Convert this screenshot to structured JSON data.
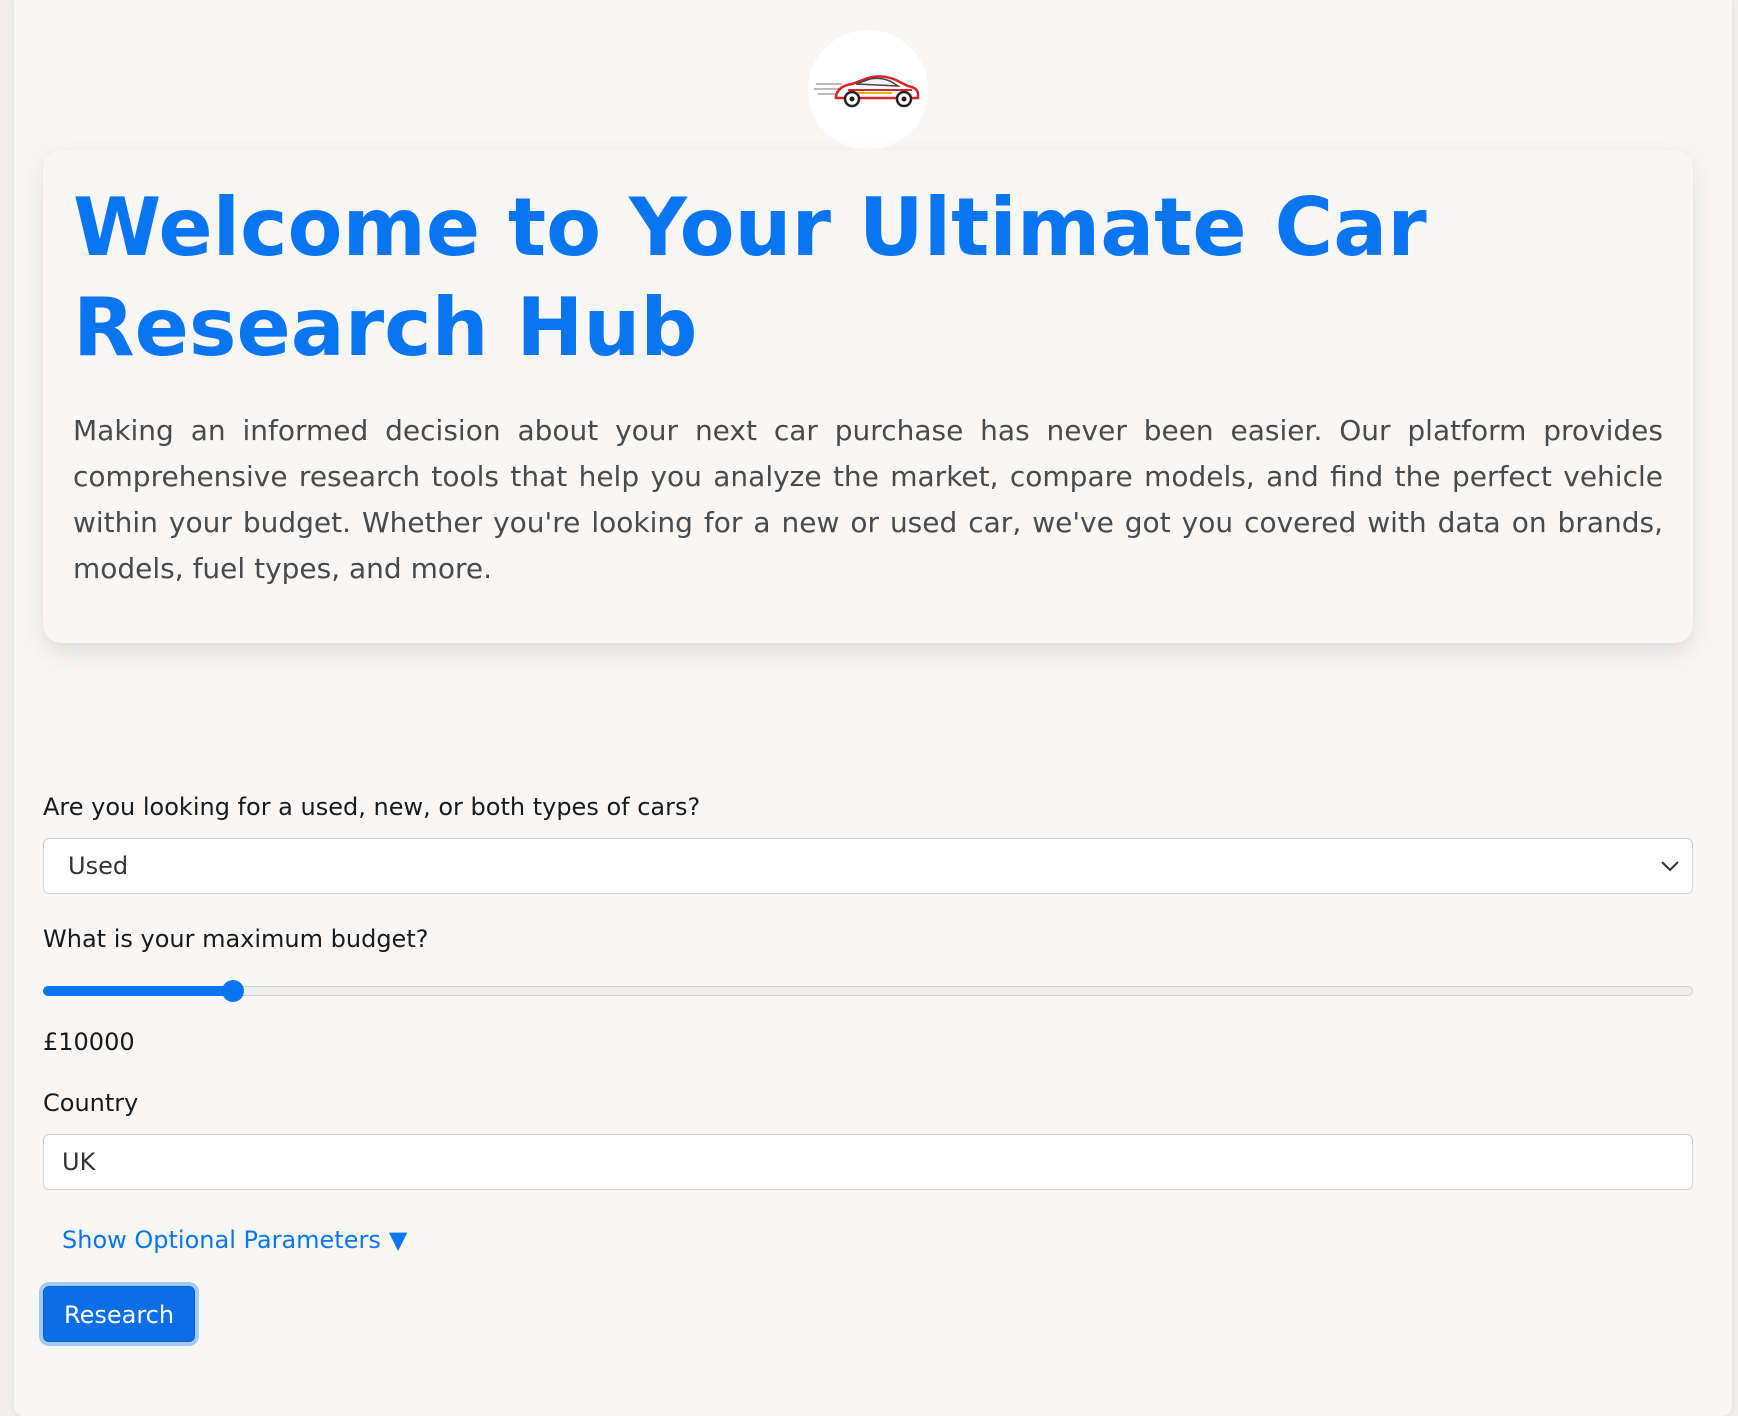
{
  "logo": {
    "icon": "car-logo-icon"
  },
  "hero": {
    "title": "Welcome to Your Ultimate Car Research Hub",
    "description": "Making an informed decision about your next car purchase has never been easier. Our platform provides comprehensive research tools that help you analyze the market, compare models, and find the perfect vehicle within your budget. Whether you're looking for a new or used car, we've got you covered with data on brands, models, fuel types, and more."
  },
  "form": {
    "car_type": {
      "label": "Are you looking for a used, new, or both types of cars?",
      "value": "Used"
    },
    "budget": {
      "label": "What is your maximum budget?",
      "value_text": "£10000",
      "slider_fraction": 0.115
    },
    "country": {
      "label": "Country",
      "value": "UK"
    },
    "optional_toggle": {
      "label": "Show Optional Parameters",
      "arrow": "▼"
    },
    "submit_label": "Research"
  },
  "colors": {
    "accent": "#0a75f0",
    "text": "#1a1a1a",
    "muted_text": "#4a4a4a",
    "background": "#f8f7f6"
  }
}
